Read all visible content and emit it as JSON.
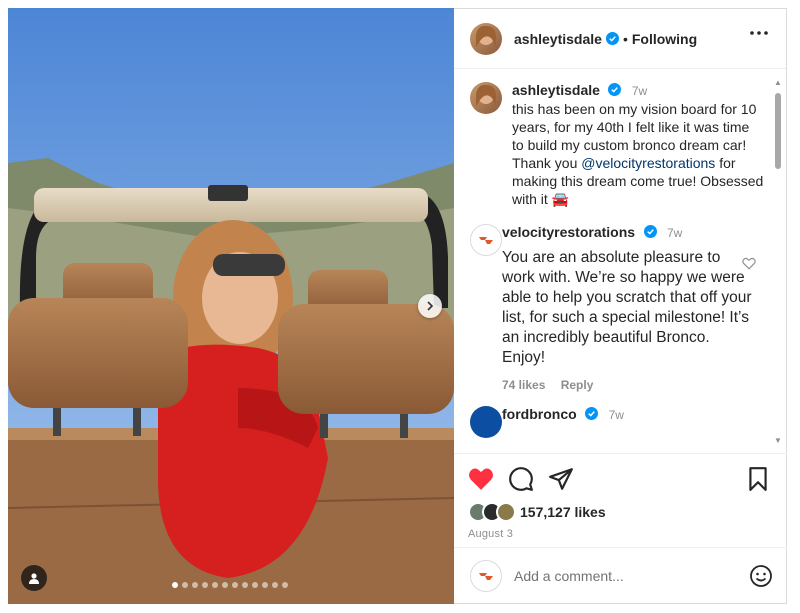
{
  "post": {
    "username": "ashleytisdale",
    "follow_status": "Following",
    "separator": "•",
    "more_icon": "more-horizontal-icon",
    "carousel": {
      "slide_count": 12,
      "active_index": 0
    }
  },
  "caption": {
    "username": "ashleytisdale",
    "time": "7w",
    "text_before": "this has been on my vision board for 10 years, for my 40th I felt like it was time to build my custom bronco dream car! Thank you ",
    "mention": "@velocityrestorations",
    "text_after": " for making this dream come true! Obsessed with it 🚘"
  },
  "comments": [
    {
      "username": "velocityrestorations",
      "time": "7w",
      "text": "You are an absolute pleasure to work with. We’re so happy we were able to help you scratch that off your list, for such a special milestone! It’s an incredibly beautiful Bronco. Enjoy!",
      "likes": "74 likes",
      "reply_label": "Reply"
    },
    {
      "username": "fordbronco",
      "time": "7w"
    }
  ],
  "actions": {
    "like_icon": "heart-filled-icon",
    "comment_icon": "comment-icon",
    "share_icon": "send-icon",
    "save_icon": "bookmark-icon",
    "liked_color": "#ff3040"
  },
  "likes": {
    "count_text": "157,127 likes"
  },
  "date": "August 3",
  "add_comment": {
    "placeholder": "Add a comment...",
    "emoji_icon": "smiley-icon"
  },
  "colors": {
    "verified": "#0095f6",
    "mention": "#00376b",
    "meta": "#8e8e8e"
  }
}
